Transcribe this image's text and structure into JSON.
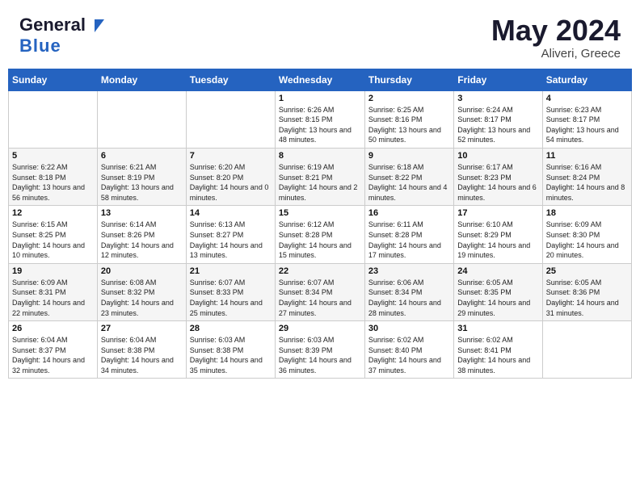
{
  "header": {
    "logo_line1": "General",
    "logo_line2": "Blue",
    "month": "May 2024",
    "location": "Aliveri, Greece"
  },
  "weekdays": [
    "Sunday",
    "Monday",
    "Tuesday",
    "Wednesday",
    "Thursday",
    "Friday",
    "Saturday"
  ],
  "weeks": [
    [
      {
        "day": "",
        "sunrise": "",
        "sunset": "",
        "daylight": ""
      },
      {
        "day": "",
        "sunrise": "",
        "sunset": "",
        "daylight": ""
      },
      {
        "day": "",
        "sunrise": "",
        "sunset": "",
        "daylight": ""
      },
      {
        "day": "1",
        "sunrise": "Sunrise: 6:26 AM",
        "sunset": "Sunset: 8:15 PM",
        "daylight": "Daylight: 13 hours and 48 minutes."
      },
      {
        "day": "2",
        "sunrise": "Sunrise: 6:25 AM",
        "sunset": "Sunset: 8:16 PM",
        "daylight": "Daylight: 13 hours and 50 minutes."
      },
      {
        "day": "3",
        "sunrise": "Sunrise: 6:24 AM",
        "sunset": "Sunset: 8:17 PM",
        "daylight": "Daylight: 13 hours and 52 minutes."
      },
      {
        "day": "4",
        "sunrise": "Sunrise: 6:23 AM",
        "sunset": "Sunset: 8:17 PM",
        "daylight": "Daylight: 13 hours and 54 minutes."
      }
    ],
    [
      {
        "day": "5",
        "sunrise": "Sunrise: 6:22 AM",
        "sunset": "Sunset: 8:18 PM",
        "daylight": "Daylight: 13 hours and 56 minutes."
      },
      {
        "day": "6",
        "sunrise": "Sunrise: 6:21 AM",
        "sunset": "Sunset: 8:19 PM",
        "daylight": "Daylight: 13 hours and 58 minutes."
      },
      {
        "day": "7",
        "sunrise": "Sunrise: 6:20 AM",
        "sunset": "Sunset: 8:20 PM",
        "daylight": "Daylight: 14 hours and 0 minutes."
      },
      {
        "day": "8",
        "sunrise": "Sunrise: 6:19 AM",
        "sunset": "Sunset: 8:21 PM",
        "daylight": "Daylight: 14 hours and 2 minutes."
      },
      {
        "day": "9",
        "sunrise": "Sunrise: 6:18 AM",
        "sunset": "Sunset: 8:22 PM",
        "daylight": "Daylight: 14 hours and 4 minutes."
      },
      {
        "day": "10",
        "sunrise": "Sunrise: 6:17 AM",
        "sunset": "Sunset: 8:23 PM",
        "daylight": "Daylight: 14 hours and 6 minutes."
      },
      {
        "day": "11",
        "sunrise": "Sunrise: 6:16 AM",
        "sunset": "Sunset: 8:24 PM",
        "daylight": "Daylight: 14 hours and 8 minutes."
      }
    ],
    [
      {
        "day": "12",
        "sunrise": "Sunrise: 6:15 AM",
        "sunset": "Sunset: 8:25 PM",
        "daylight": "Daylight: 14 hours and 10 minutes."
      },
      {
        "day": "13",
        "sunrise": "Sunrise: 6:14 AM",
        "sunset": "Sunset: 8:26 PM",
        "daylight": "Daylight: 14 hours and 12 minutes."
      },
      {
        "day": "14",
        "sunrise": "Sunrise: 6:13 AM",
        "sunset": "Sunset: 8:27 PM",
        "daylight": "Daylight: 14 hours and 13 minutes."
      },
      {
        "day": "15",
        "sunrise": "Sunrise: 6:12 AM",
        "sunset": "Sunset: 8:28 PM",
        "daylight": "Daylight: 14 hours and 15 minutes."
      },
      {
        "day": "16",
        "sunrise": "Sunrise: 6:11 AM",
        "sunset": "Sunset: 8:28 PM",
        "daylight": "Daylight: 14 hours and 17 minutes."
      },
      {
        "day": "17",
        "sunrise": "Sunrise: 6:10 AM",
        "sunset": "Sunset: 8:29 PM",
        "daylight": "Daylight: 14 hours and 19 minutes."
      },
      {
        "day": "18",
        "sunrise": "Sunrise: 6:09 AM",
        "sunset": "Sunset: 8:30 PM",
        "daylight": "Daylight: 14 hours and 20 minutes."
      }
    ],
    [
      {
        "day": "19",
        "sunrise": "Sunrise: 6:09 AM",
        "sunset": "Sunset: 8:31 PM",
        "daylight": "Daylight: 14 hours and 22 minutes."
      },
      {
        "day": "20",
        "sunrise": "Sunrise: 6:08 AM",
        "sunset": "Sunset: 8:32 PM",
        "daylight": "Daylight: 14 hours and 23 minutes."
      },
      {
        "day": "21",
        "sunrise": "Sunrise: 6:07 AM",
        "sunset": "Sunset: 8:33 PM",
        "daylight": "Daylight: 14 hours and 25 minutes."
      },
      {
        "day": "22",
        "sunrise": "Sunrise: 6:07 AM",
        "sunset": "Sunset: 8:34 PM",
        "daylight": "Daylight: 14 hours and 27 minutes."
      },
      {
        "day": "23",
        "sunrise": "Sunrise: 6:06 AM",
        "sunset": "Sunset: 8:34 PM",
        "daylight": "Daylight: 14 hours and 28 minutes."
      },
      {
        "day": "24",
        "sunrise": "Sunrise: 6:05 AM",
        "sunset": "Sunset: 8:35 PM",
        "daylight": "Daylight: 14 hours and 29 minutes."
      },
      {
        "day": "25",
        "sunrise": "Sunrise: 6:05 AM",
        "sunset": "Sunset: 8:36 PM",
        "daylight": "Daylight: 14 hours and 31 minutes."
      }
    ],
    [
      {
        "day": "26",
        "sunrise": "Sunrise: 6:04 AM",
        "sunset": "Sunset: 8:37 PM",
        "daylight": "Daylight: 14 hours and 32 minutes."
      },
      {
        "day": "27",
        "sunrise": "Sunrise: 6:04 AM",
        "sunset": "Sunset: 8:38 PM",
        "daylight": "Daylight: 14 hours and 34 minutes."
      },
      {
        "day": "28",
        "sunrise": "Sunrise: 6:03 AM",
        "sunset": "Sunset: 8:38 PM",
        "daylight": "Daylight: 14 hours and 35 minutes."
      },
      {
        "day": "29",
        "sunrise": "Sunrise: 6:03 AM",
        "sunset": "Sunset: 8:39 PM",
        "daylight": "Daylight: 14 hours and 36 minutes."
      },
      {
        "day": "30",
        "sunrise": "Sunrise: 6:02 AM",
        "sunset": "Sunset: 8:40 PM",
        "daylight": "Daylight: 14 hours and 37 minutes."
      },
      {
        "day": "31",
        "sunrise": "Sunrise: 6:02 AM",
        "sunset": "Sunset: 8:41 PM",
        "daylight": "Daylight: 14 hours and 38 minutes."
      },
      {
        "day": "",
        "sunrise": "",
        "sunset": "",
        "daylight": ""
      }
    ]
  ]
}
